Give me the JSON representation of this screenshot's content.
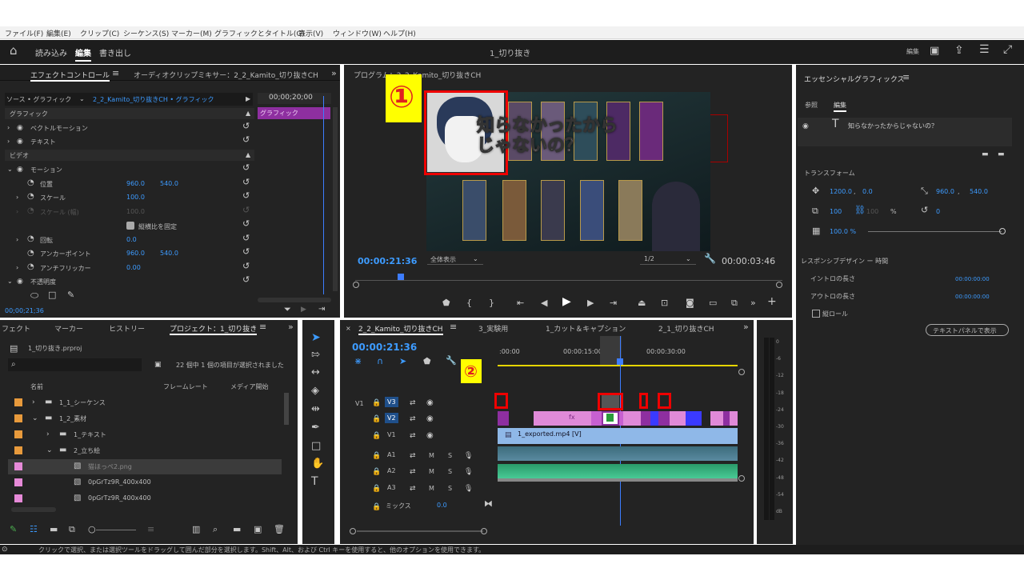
{
  "menu": [
    "ファイル(F)",
    "編集(E)",
    "クリップ(C)",
    "シーケンス(S)",
    "マーカー(M)",
    "グラフィックとタイトル(G)",
    "表示(V)",
    "ウィンドウ(W)",
    "ヘルプ(H)"
  ],
  "workspace": {
    "tabs": [
      "読み込み",
      "編集",
      "書き出し"
    ],
    "title": "1_切り抜き",
    "right_label": "編集"
  },
  "effect_controls": {
    "tab": "エフェクトコントロール",
    "tab2": "オーディオクリップミキサー：2_2_Kamito_切り抜きCH",
    "source": "ソース • グラフィック",
    "source_seq": "2_2_Kamito_切り抜きCH • グラフィック",
    "timecode_head": "00;00;20;00",
    "clip_label": "グラフィック",
    "section_graphic": "グラフィック",
    "vector": "ベクトルモーション",
    "text": "テキスト",
    "section_video": "ビデオ",
    "motion": "モーション",
    "position_label": "位置",
    "position_x": "960.0",
    "position_y": "540.0",
    "scale_label": "スケール",
    "scale": "100.0",
    "scale_w_label": "スケール (幅)",
    "scale_w": "100.0",
    "uniform": "縦横比を固定",
    "rotation_label": "回転",
    "rotation": "0.0",
    "anchor_label": "アンカーポイント",
    "anchor_x": "960.0",
    "anchor_y": "540.0",
    "flicker_label": "アンチフリッカー",
    "flicker": "0.00",
    "opacity_label": "不透明度",
    "bottom_tc": "00;00;21;36"
  },
  "program": {
    "title": "プログラム：2_2_Kamito_切り抜きCH",
    "timecode": "00:00:21:36",
    "fit": "全体表示",
    "res": "1/2",
    "duration": "00:00:03:46",
    "caption_line1": "知らなかったから",
    "caption_line2": "じゃないの？",
    "annotation": "①"
  },
  "essential": {
    "title": "エッセンシャルグラフィックス",
    "tab_browse": "参照",
    "tab_edit": "編集",
    "layer_text": "知らなかったからじゃないの？",
    "transform": "トランスフォーム",
    "pos_x": "1200.0",
    "pos_y": "0.0",
    "anchor_x": "960.0",
    "anchor_y": "540.0",
    "scale": "100",
    "scale2": "100",
    "pct": "%",
    "rotation": "0",
    "opacity": "100.0 %",
    "responsive": "レスポンシブデザイン ー 時間",
    "intro": "イントロの長さ",
    "intro_val": "00:00:00:00",
    "outro": "アウトロの長さ",
    "outro_val": "00:00:00:00",
    "roll": "縦ロール",
    "textpanel": "テキストパネルで表示"
  },
  "project": {
    "tabs": [
      "フェクト",
      "マーカー",
      "ヒストリー",
      "プロジェクト：1_切り抜き"
    ],
    "file": "1_切り抜き.prproj",
    "status": "22 個中 1 個の項目が選択されました",
    "col_name": "名前",
    "col_fps": "フレームレート",
    "col_media": "メディア開始",
    "items": [
      {
        "name": "1_1_シーケンス",
        "color": "#e89a3c",
        "indent": 0,
        "type": "folder",
        "arrow": "›"
      },
      {
        "name": "1_2_素材",
        "color": "#e89a3c",
        "indent": 0,
        "type": "folder",
        "arrow": "⌄"
      },
      {
        "name": "1_テキスト",
        "color": "#e89a3c",
        "indent": 1,
        "type": "folder",
        "arrow": "›"
      },
      {
        "name": "2_立ち絵",
        "color": "#e89a3c",
        "indent": 1,
        "type": "folder",
        "arrow": "⌄"
      },
      {
        "name": "猫ほっぺ2.png",
        "color": "#e68ad8",
        "indent": 2,
        "type": "image",
        "arrow": ""
      },
      {
        "name": "0pGrTz9R_400x400",
        "color": "#e68ad8",
        "indent": 2,
        "type": "image",
        "arrow": ""
      },
      {
        "name": "0pGrTz9R_400x400",
        "color": "#e68ad8",
        "indent": 2,
        "type": "image",
        "arrow": ""
      }
    ]
  },
  "timeline": {
    "tabs": [
      "2_2_Kamito_切り抜きCH",
      "3_実験用",
      "1_カット＆キャプション",
      "2_1_切り抜きCH"
    ],
    "timecode": "00:00:21:36",
    "ruler": [
      ":00:00",
      "00:00:15:00",
      "00:00:30:00"
    ],
    "tracks": [
      "V3",
      "V2",
      "V1",
      "A1",
      "A2",
      "A3"
    ],
    "mix": "ミックス",
    "mix_val": "0.0",
    "clip_v1": "1_exported.mp4 [V]",
    "annotation": "②",
    "meter": [
      "0",
      "-6",
      "-12",
      "-18",
      "-24",
      "-30",
      "-36",
      "-42",
      "-48",
      "-54",
      "dB"
    ]
  },
  "status": "クリックで選択、または選択ツールをドラッグして囲んだ部分を選択します。Shift、Alt、および Ctrl キーを使用すると、他のオプションを使用できます。"
}
